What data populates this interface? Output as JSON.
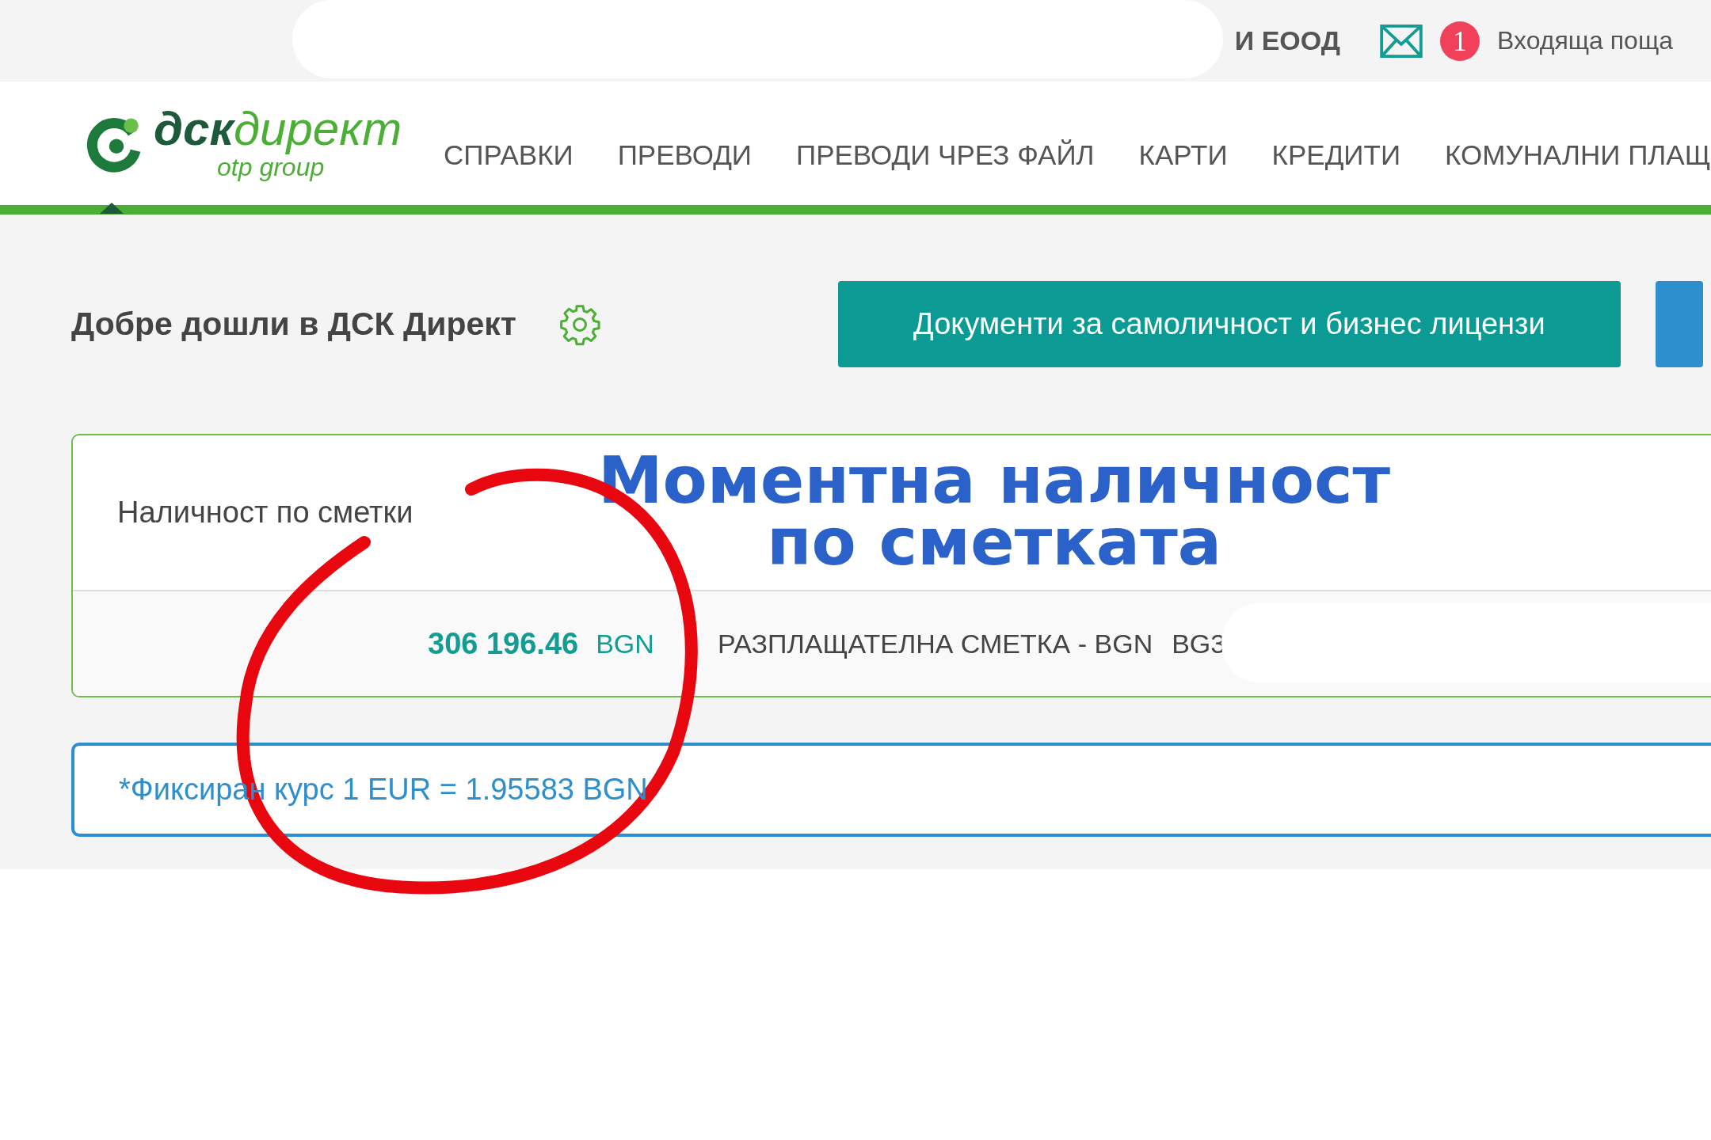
{
  "top_bar": {
    "company": "И ЕООД",
    "badge": "1",
    "inbox": "Входяща поща"
  },
  "logo": {
    "name": "дск",
    "name_suffix": "директ",
    "group": "otp group"
  },
  "nav": [
    "СПРАВКИ",
    "ПРЕВОДИ",
    "ПРЕВОДИ ЧРЕЗ ФАЙЛ",
    "КАРТИ",
    "КРЕДИТИ",
    "КОМУНАЛНИ ПЛАЩ"
  ],
  "welcome": "Добре дошли в ДСК Директ",
  "documents_button": "Документи за самоличност и бизнес лицензи",
  "balance_card": {
    "title": "Наличност по сметки",
    "accounts": [
      {
        "amount": "306 196.46",
        "currency": "BGN",
        "name": "РАЗПЛАЩАТЕЛНА СМЕТКА - BGN",
        "iban": "BG3"
      }
    ]
  },
  "notice": "*Фиксиран курс 1 EUR = 1.95583 BGN",
  "annotation": {
    "lines": [
      "Моментна наличност",
      "по сметката"
    ]
  }
}
